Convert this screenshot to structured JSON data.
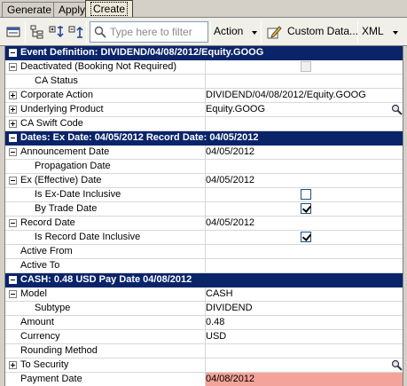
{
  "tabs": [
    {
      "label": "Generate"
    },
    {
      "label": "Apply"
    },
    {
      "label": "Create",
      "active": true
    }
  ],
  "toolbar": {
    "filter_placeholder": "Type here to filter",
    "action_label": "Action",
    "custom_data_label": "Custom Data...",
    "xml_label": "XML"
  },
  "rows": [
    {
      "type": "section",
      "expander": "minus",
      "name": "Event Definition: DIVIDEND/04/08/2012/Equity.GOOG"
    },
    {
      "type": "prop",
      "expander": "minus",
      "indent": 1,
      "name": "Deactivated (Booking Not Required)",
      "value": "",
      "checkbox": "disabled"
    },
    {
      "type": "prop",
      "expander": "",
      "indent": 2,
      "name": "CA Status",
      "value": ""
    },
    {
      "type": "prop",
      "expander": "plus",
      "indent": 1,
      "name": "Corporate Action",
      "value": "DIVIDEND/04/08/2012/Equity.GOOG"
    },
    {
      "type": "prop",
      "expander": "plus",
      "indent": 1,
      "name": "Underlying Product",
      "value": "Equity.GOOG",
      "lookup": true
    },
    {
      "type": "prop",
      "expander": "plus",
      "indent": 1,
      "name": "CA Swift Code",
      "value": ""
    },
    {
      "type": "section",
      "expander": "minus",
      "name": "Dates:  Ex Date: 04/05/2012 Record Date: 04/05/2012"
    },
    {
      "type": "prop",
      "expander": "minus",
      "indent": 1,
      "name": "Announcement Date",
      "value": "04/05/2012"
    },
    {
      "type": "prop",
      "expander": "",
      "indent": 2,
      "name": "Propagation Date",
      "value": ""
    },
    {
      "type": "prop",
      "expander": "minus",
      "indent": 1,
      "name": "Ex (Effective) Date",
      "value": "04/05/2012"
    },
    {
      "type": "prop",
      "expander": "",
      "indent": 2,
      "name": "Is Ex-Date Inclusive",
      "value": "",
      "checkbox": "unchecked"
    },
    {
      "type": "prop",
      "expander": "",
      "indent": 2,
      "name": "By Trade Date",
      "value": "",
      "checkbox": "checked"
    },
    {
      "type": "prop",
      "expander": "minus",
      "indent": 1,
      "name": "Record Date",
      "value": "04/05/2012"
    },
    {
      "type": "prop",
      "expander": "",
      "indent": 2,
      "name": "Is Record Date Inclusive",
      "value": "",
      "checkbox": "checked"
    },
    {
      "type": "prop",
      "expander": "",
      "indent": 1,
      "name": "Active From",
      "value": ""
    },
    {
      "type": "prop",
      "expander": "",
      "indent": 1,
      "name": "Active To",
      "value": ""
    },
    {
      "type": "section",
      "expander": "minus",
      "name": "CASH: 0.48  USD Pay Date 04/08/2012"
    },
    {
      "type": "prop",
      "expander": "minus",
      "indent": 1,
      "name": "Model",
      "value": "CASH"
    },
    {
      "type": "prop",
      "expander": "",
      "indent": 2,
      "name": "Subtype",
      "value": "DIVIDEND"
    },
    {
      "type": "prop",
      "expander": "",
      "indent": 1,
      "name": "Amount",
      "value": "0.48"
    },
    {
      "type": "prop",
      "expander": "",
      "indent": 1,
      "name": "Currency",
      "value": "USD"
    },
    {
      "type": "prop",
      "expander": "",
      "indent": 1,
      "name": "Rounding Method",
      "value": ""
    },
    {
      "type": "prop",
      "expander": "plus",
      "indent": 1,
      "name": "To Security",
      "value": "",
      "lookup": true
    },
    {
      "type": "prop",
      "expander": "",
      "indent": 1,
      "name": "Payment Date",
      "value": "04/08/2012",
      "highlight": true
    }
  ],
  "colors": {
    "section_bg": "#0a246a",
    "highlight_bg": "#f4a39a"
  },
  "icons": {
    "toolbar": [
      "properties-icon",
      "tree-view-icon",
      "expand-all-icon",
      "collapse-all-icon",
      "filter-icon",
      "edit-icon"
    ],
    "lookup": "magnifier-icon"
  }
}
